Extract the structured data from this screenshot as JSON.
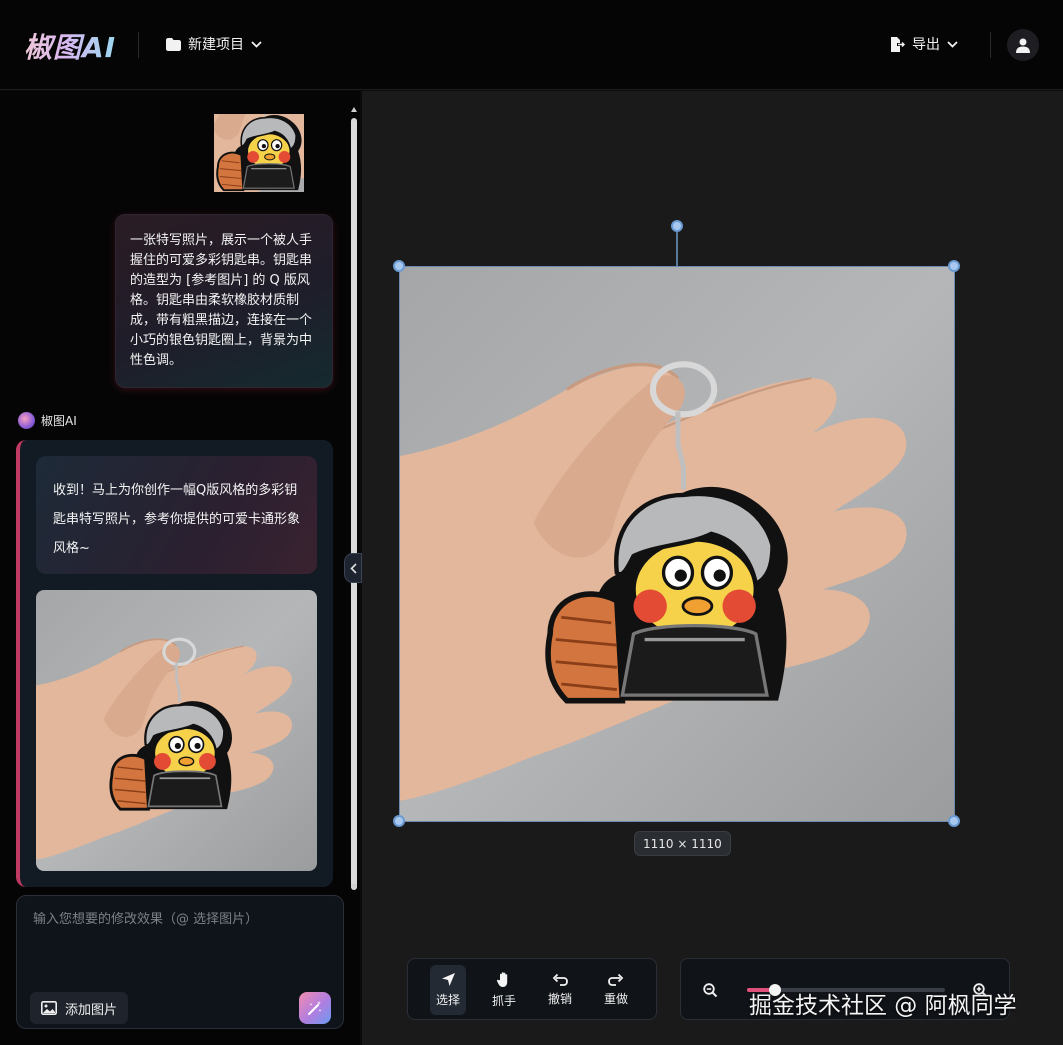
{
  "header": {
    "logo": "椒图AI",
    "project_label": "新建项目",
    "export_label": "导出"
  },
  "chat": {
    "user_message": "一张特写照片，展示一个被人手握住的可爱多彩钥匙串。钥匙串的造型为 [参考图片] 的 Q 版风格。钥匙串由柔软橡胶材质制成，带有粗黑描边，连接在一个小巧的银色钥匙圈上，背景为中性色调。",
    "ai_name": "椒图AI",
    "ai_message": "收到！马上为你创作一幅Q版风格的多彩钥匙串特写照片，参考你提供的可爱卡通形象风格~",
    "input_placeholder": "输入您想要的修改效果（@ 选择图片）",
    "add_image_label": "添加图片"
  },
  "canvas": {
    "dimensions": "1110 × 1110"
  },
  "toolbar": {
    "tools": [
      {
        "label": "选择",
        "icon": "select-arrow-icon"
      },
      {
        "label": "抓手",
        "icon": "hand-icon"
      },
      {
        "label": "撤销",
        "icon": "undo-icon"
      },
      {
        "label": "重做",
        "icon": "redo-icon"
      }
    ]
  },
  "zoom": {
    "level_fraction": 0.14
  },
  "watermark": "掘金技术社区 @ 阿枫同学",
  "colors": {
    "accent": "#e0507a",
    "background": "#050505",
    "canvas": "#1a1a1b"
  }
}
